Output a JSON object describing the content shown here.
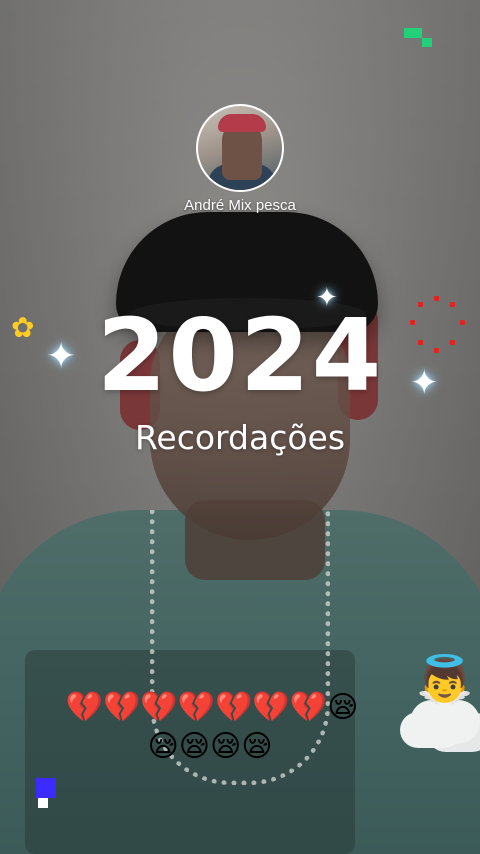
{
  "profile": {
    "username": "André Mix pesca",
    "avatar_icon": "profile-photo"
  },
  "story": {
    "year": "2024",
    "subtitle": "Recordações"
  },
  "stickers": {
    "broken_hearts": "💔💔💔💔💔💔💔😪",
    "sleepy_faces": "😪😪😪😪",
    "cupid_icon": "cupid-heart-sticker"
  },
  "colors": {
    "title_text": "#ffffff",
    "sparkle_glow": "#9fd8ff",
    "ring_dots": "#e2231f",
    "flower": "#ffcc22",
    "pixel_green": "#22d07a",
    "pixel_blue": "#3b2bff"
  }
}
